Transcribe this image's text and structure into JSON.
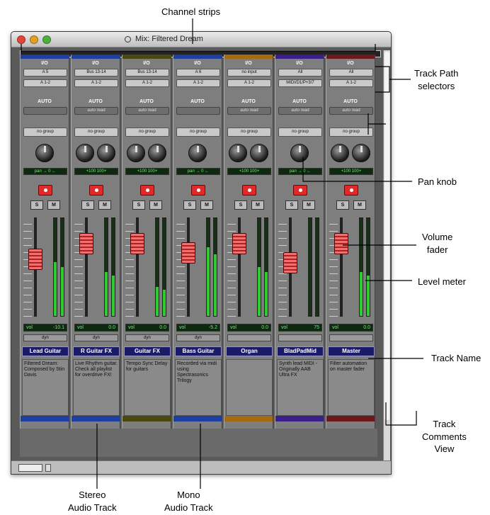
{
  "window": {
    "title": "Mix: Filtered Dream"
  },
  "callouts": {
    "channel_strips": "Channel strips",
    "track_path_selectors": [
      "Track Path",
      "selectors"
    ],
    "pan_knob": "Pan knob",
    "volume_fader": [
      "Volume",
      "fader"
    ],
    "level_meter": "Level meter",
    "track_name": "Track Name",
    "track_comments_view": [
      "Track",
      "Comments",
      "View"
    ],
    "stereo_audio_track": [
      "Stereo",
      "Audio Track"
    ],
    "mono_audio_track": [
      "Mono",
      "Audio Track"
    ]
  },
  "strip_common": {
    "io_label": "I/O",
    "auto_label": "AUTO",
    "solo": "S",
    "mute": "M",
    "vol_label": "vol"
  },
  "tracks": [
    {
      "name": "Lead Guitar",
      "color": "#1c3fa0",
      "input": "A 5",
      "output": "A 1-2",
      "auto": "",
      "group": "no group",
      "pan": "pan  → 0 ←",
      "vol": "-10.1",
      "dyn": "dyn",
      "comment": "Filtered Dream: Composed by Stin Davis",
      "meter": 0.55,
      "fader": 0.6
    },
    {
      "name": "R Guitar FX",
      "color": "#1c3fa0",
      "input": "Bus 13-14",
      "output": "A 1-2",
      "auto": "auto read",
      "group": "no group",
      "pan": "+100   100+",
      "vol": "0.0",
      "dyn": "dyn",
      "comment": "Live Rhythm guitar. Check all playlist for overdrive FX!",
      "meter": 0.45,
      "fader": 0.8
    },
    {
      "name": "Guitar FX",
      "color": "#4a4a10",
      "input": "Bus 13-14",
      "output": "A 1-2",
      "auto": "auto read",
      "group": "no group",
      "pan": "+100   100+",
      "vol": "0.0",
      "dyn": "dyn",
      "comment": "Tempo Sync Delay for guitars",
      "meter": 0.3,
      "fader": 0.8
    },
    {
      "name": "Bass Guitar",
      "color": "#1c3fa0",
      "input": "A 6",
      "output": "A 1-2",
      "auto": "",
      "group": "no group",
      "pan": "pan  → 0 ←",
      "vol": "-5.2",
      "dyn": "dyn",
      "comment": "Recorded via midi using Spectrasonics Trilogy",
      "meter": 0.7,
      "fader": 0.68
    },
    {
      "name": "Organ",
      "color": "#a86a10",
      "input": "no input",
      "output": "A 1-2",
      "auto": "auto read",
      "group": "no group",
      "pan": "+100   100+",
      "vol": "0.0",
      "dyn": "",
      "comment": "",
      "meter": 0.5,
      "fader": 0.8
    },
    {
      "name": "BladPadMid",
      "color": "#3a1f8a",
      "input": "All",
      "output": "MIDI/D1/P+3/7",
      "auto": "auto read",
      "group": "no group",
      "pan": "pan  → 0 ←",
      "vol": "75",
      "dyn": "",
      "comment": "Synth lead MIDI - Originally AAB Ultra FX",
      "meter": 0.0,
      "fader": 0.55
    },
    {
      "name": "Master",
      "color": "#6a1a1a",
      "input": "All",
      "output": "A 1-2",
      "auto": "auto read",
      "group": "no group",
      "pan": "+100   100+",
      "vol": "0.0",
      "dyn": "",
      "comment": "Filter automation on master fader",
      "meter": 0.45,
      "fader": 0.8
    }
  ]
}
